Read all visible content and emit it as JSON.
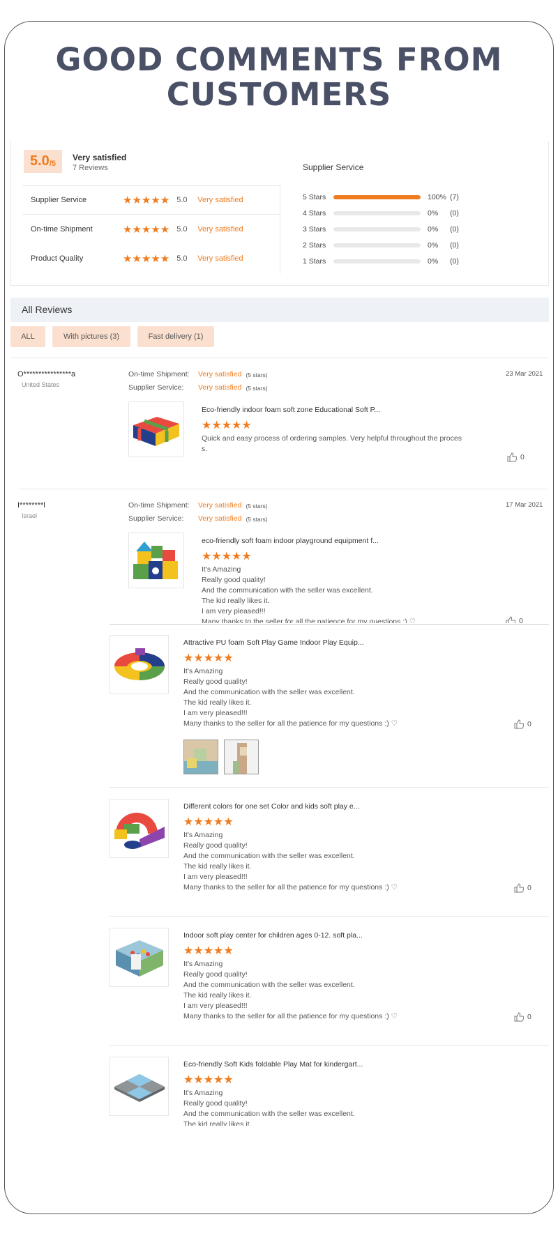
{
  "headline": {
    "line1": "GOOD COMMENTS FROM",
    "line2": "CUSTOMERS"
  },
  "summary": {
    "score": "5.0",
    "score_max": "/5",
    "satisfaction": "Very satisfied",
    "reviews_count": "7 Reviews",
    "rows": [
      {
        "label": "Supplier Service",
        "value": "5.0",
        "status": "Very satisfied"
      },
      {
        "label": "On-time Shipment",
        "value": "5.0",
        "status": "Very satisfied"
      },
      {
        "label": "Product Quality",
        "value": "5.0",
        "status": "Very satisfied"
      }
    ],
    "stars": "★★★★★"
  },
  "supplier_service": {
    "title": "Supplier Service",
    "rows": [
      {
        "label": "5 Stars",
        "pct_text": "100%",
        "count": "(7)",
        "fraction": 1.0
      },
      {
        "label": "4 Stars",
        "pct_text": "0%",
        "count": "(0)",
        "fraction": 0
      },
      {
        "label": "3 Stars",
        "pct_text": "0%",
        "count": "(0)",
        "fraction": 0
      },
      {
        "label": "2 Stars",
        "pct_text": "0%",
        "count": "(0)",
        "fraction": 0
      },
      {
        "label": "1 Stars",
        "pct_text": "0%",
        "count": "(0)",
        "fraction": 0
      }
    ]
  },
  "all_reviews_title": "All Reviews",
  "filters": {
    "all": "ALL",
    "pictures": "With pictures (3)",
    "fast": "Fast delivery (1)"
  },
  "meta_labels": {
    "shipment": "On-time Shipment:",
    "service": "Supplier Service:",
    "value": "Very satisfied",
    "stars": "(5 stars)"
  },
  "reviews": [
    {
      "user": "O****************a",
      "country": "United States",
      "date": "23 Mar 2021",
      "product": "Eco-friendly indoor foam soft zone Educational Soft P...",
      "comment": "Quick and easy process of ordering samples. Very helpful throughout the proces\ns.",
      "likes": "0"
    },
    {
      "user": "I********l",
      "country": "Israel",
      "date": "17 Mar 2021",
      "product": "eco-friendly soft foam indoor playground equipment f...",
      "comment": "It's Amazing\nReally good quality!\nAnd the communication with the seller was excellent.\nThe kid really likes it.\nI am very pleased!!!\nMany thanks to the seller for all the patience for my questions :) ♡",
      "likes": "0"
    }
  ],
  "sub_reviews": [
    {
      "product": "Attractive PU foam Soft Play Game Indoor Play Equip...",
      "likes": "0"
    },
    {
      "product": "Different colors for one set Color and kids soft play e...",
      "likes": "0"
    },
    {
      "product": "Indoor soft play center for children ages 0-12. soft pla...",
      "likes": "0"
    },
    {
      "product": "Eco-friendly Soft Kids foldable Play Mat for kindergart...",
      "likes": "0"
    }
  ],
  "shared_comment": "It's Amazing\nReally good quality!\nAnd the communication with the seller was excellent.\nThe kid really likes it.\nI am very pleased!!!\nMany thanks to the seller for all the patience for my questions :) ♡",
  "colors": {
    "accent": "#f07c1f",
    "chip_bg": "#fbe0cf",
    "title": "#4a5066",
    "header_bg": "#eef1f5"
  },
  "icons": {
    "like": "thumbs-up-icon",
    "star": "star-icon"
  }
}
